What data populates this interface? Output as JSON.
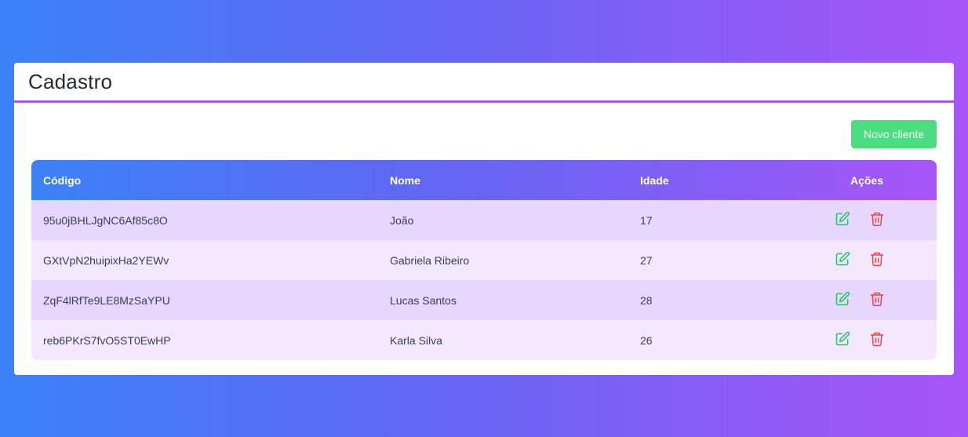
{
  "page": {
    "title": "Cadastro"
  },
  "toolbar": {
    "new_client_label": "Novo cliente"
  },
  "table": {
    "headers": {
      "codigo": "Código",
      "nome": "Nome",
      "idade": "Idade",
      "acoes": "Ações"
    },
    "rows": [
      {
        "codigo": "95u0jBHLJgNC6Af85c8O",
        "nome": "João",
        "idade": "17"
      },
      {
        "codigo": "GXtVpN2huipixHa2YEWv",
        "nome": "Gabriela Ribeiro",
        "idade": "27"
      },
      {
        "codigo": "ZqF4lRfTe9LE8MzSaYPU",
        "nome": "Lucas Santos",
        "idade": "28"
      },
      {
        "codigo": "reb6PKrS7fvO5ST0EwHP",
        "nome": "Karla Silva",
        "idade": "26"
      }
    ]
  },
  "icons": {
    "edit": "edit-icon",
    "delete": "trash-icon"
  },
  "colors": {
    "accent": "#a855f7",
    "new_button": "#4ade80",
    "edit_icon": "#22c55e",
    "delete_icon": "#ef4444"
  }
}
